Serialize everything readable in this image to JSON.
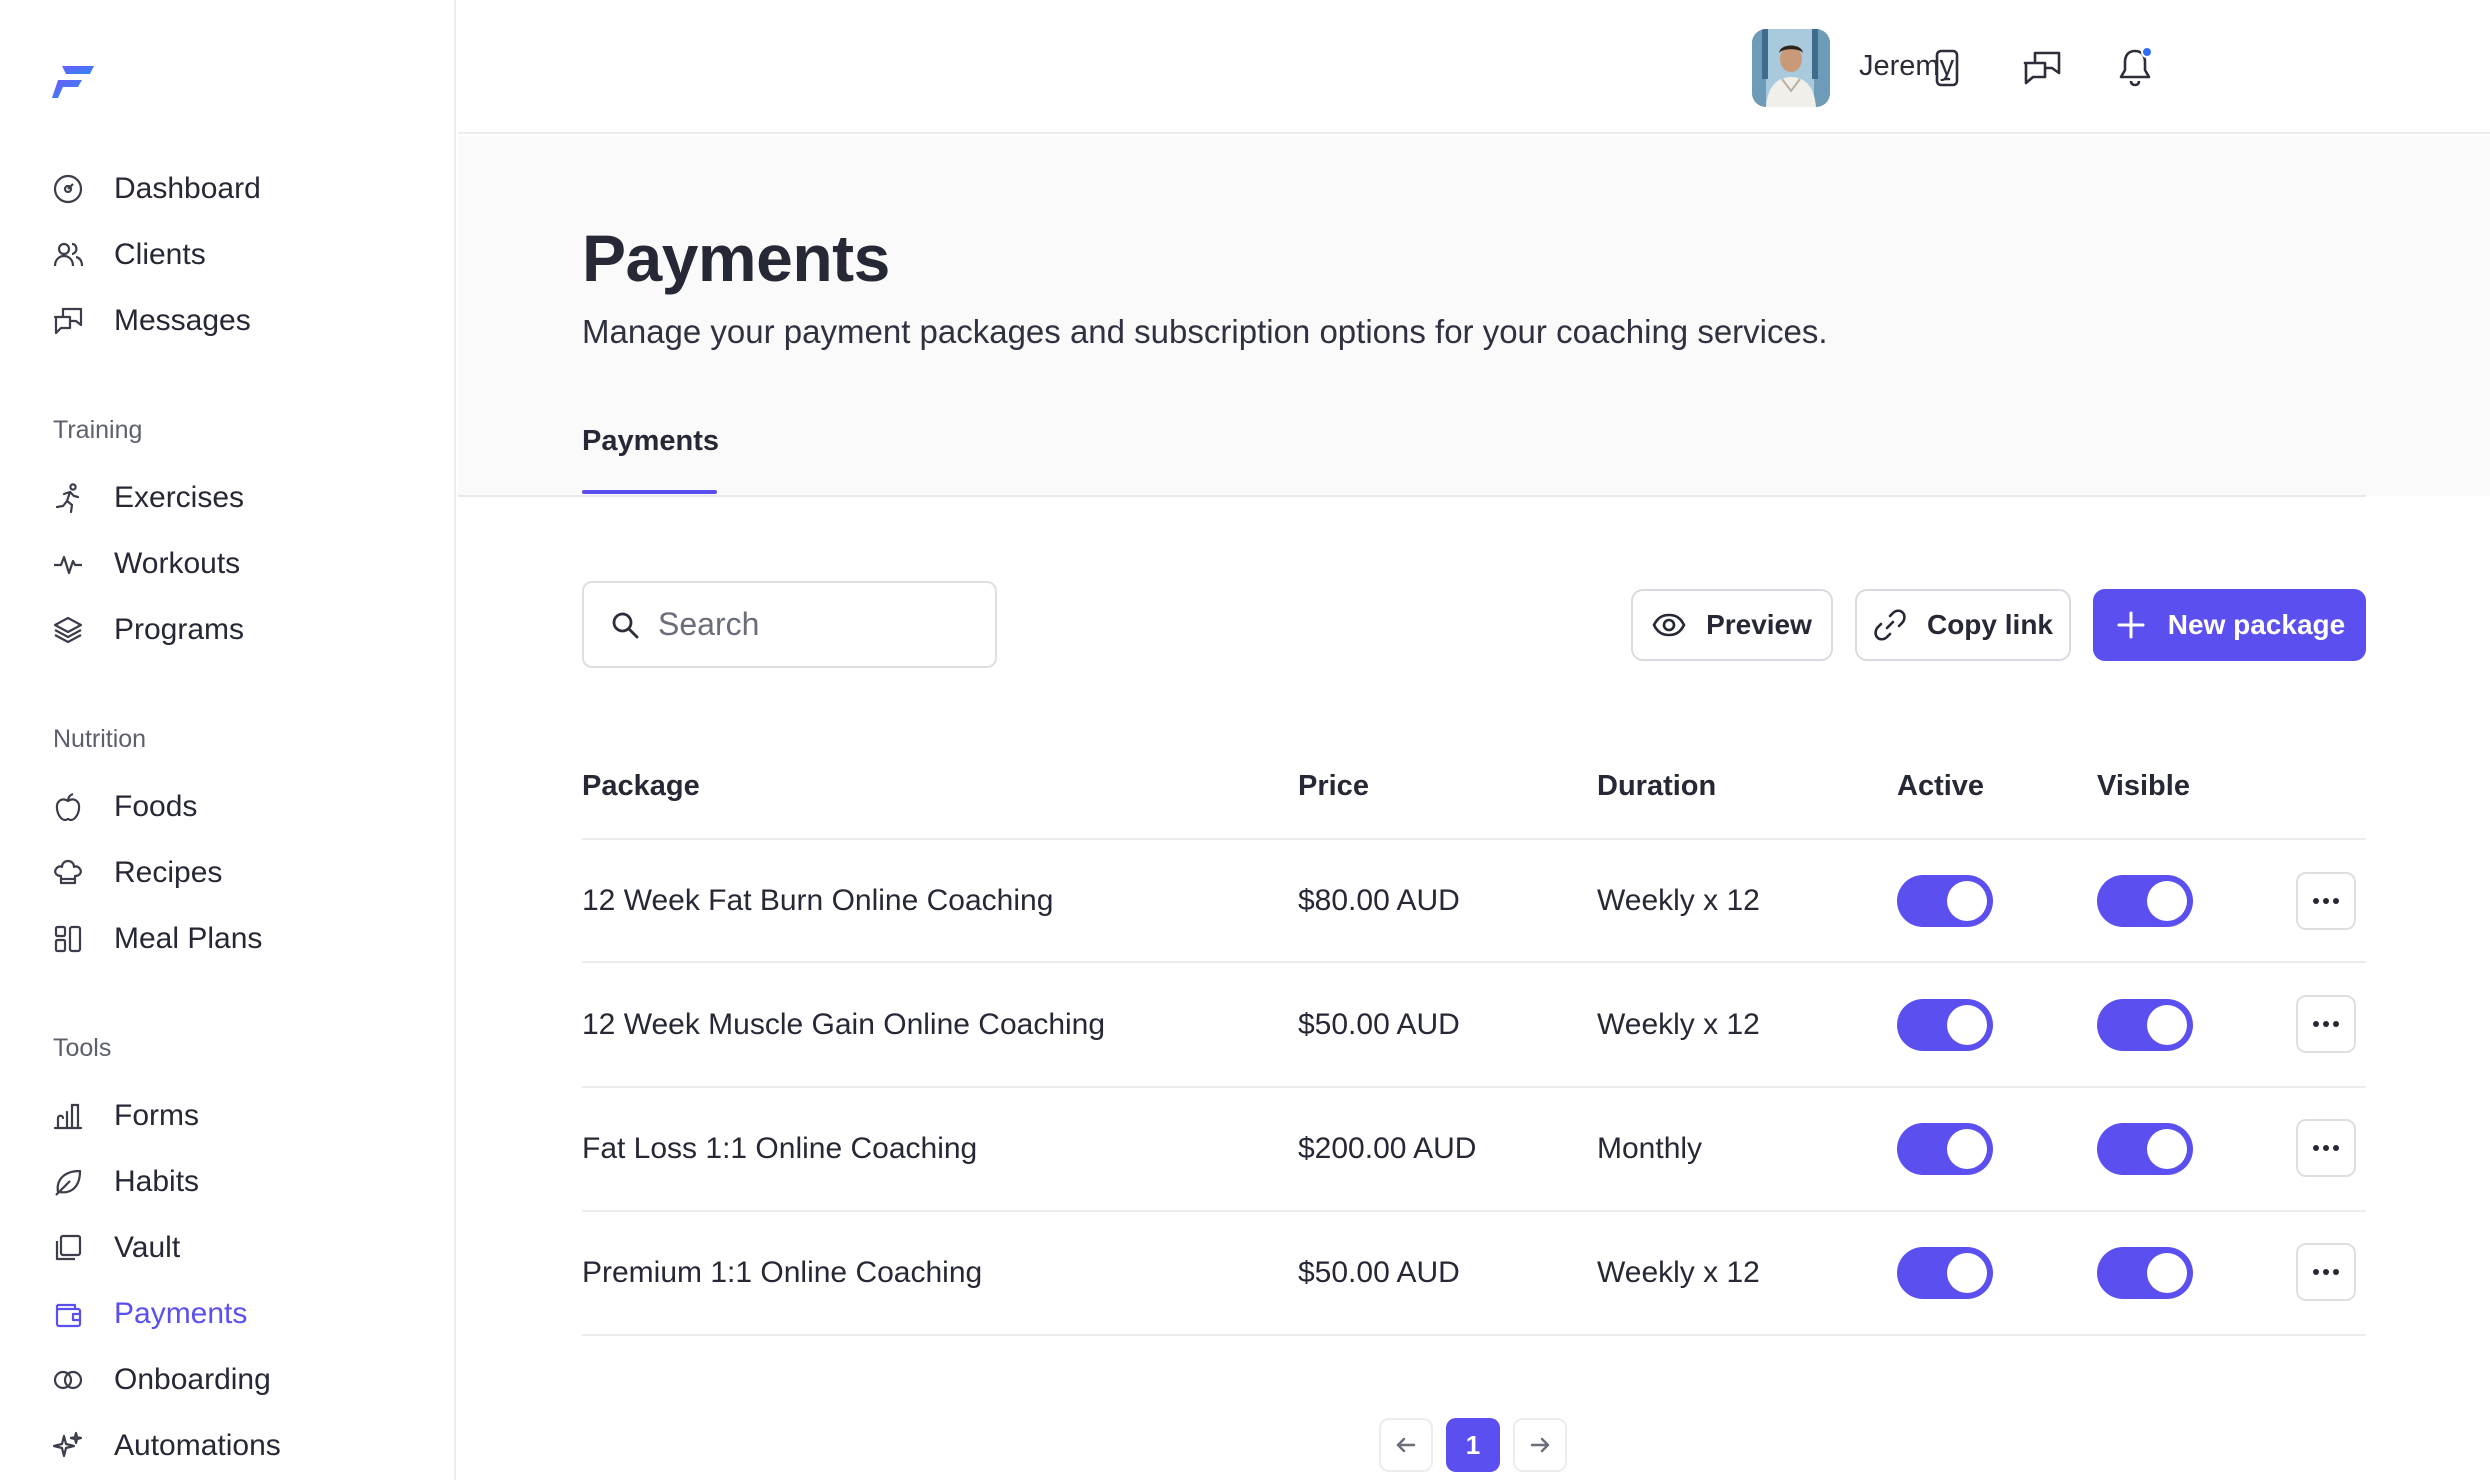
{
  "sidebar": {
    "primary": [
      {
        "label": "Dashboard",
        "icon": "gauge-icon"
      },
      {
        "label": "Clients",
        "icon": "users-icon"
      },
      {
        "label": "Messages",
        "icon": "messages-icon"
      }
    ],
    "sections": [
      {
        "title": "Training",
        "items": [
          {
            "label": "Exercises",
            "icon": "running-icon"
          },
          {
            "label": "Workouts",
            "icon": "pulse-icon"
          },
          {
            "label": "Programs",
            "icon": "layers-icon"
          }
        ]
      },
      {
        "title": "Nutrition",
        "items": [
          {
            "label": "Foods",
            "icon": "apple-icon"
          },
          {
            "label": "Recipes",
            "icon": "chef-hat-icon"
          },
          {
            "label": "Meal Plans",
            "icon": "meal-grid-icon"
          }
        ]
      },
      {
        "title": "Tools",
        "items": [
          {
            "label": "Forms",
            "icon": "forms-icon"
          },
          {
            "label": "Habits",
            "icon": "leaf-icon"
          },
          {
            "label": "Vault",
            "icon": "folders-icon"
          },
          {
            "label": "Payments",
            "icon": "wallet-icon",
            "active": true
          },
          {
            "label": "Onboarding",
            "icon": "rings-icon"
          },
          {
            "label": "Automations",
            "icon": "sparkles-icon"
          }
        ]
      }
    ]
  },
  "topbar": {
    "user_name": "Jeremy"
  },
  "header": {
    "title": "Payments",
    "subtitle": "Manage your payment packages and subscription options for your coaching services.",
    "tabs": [
      {
        "label": "Payments",
        "active": true
      }
    ]
  },
  "toolbar": {
    "search_placeholder": "Search",
    "preview_label": "Preview",
    "copy_link_label": "Copy link",
    "new_package_label": "New package"
  },
  "table": {
    "columns": [
      "Package",
      "Price",
      "Duration",
      "Active",
      "Visible"
    ],
    "rows": [
      {
        "package": "12 Week Fat Burn Online Coaching",
        "price": "$80.00 AUD",
        "duration": "Weekly x 12",
        "active": true,
        "visible": true
      },
      {
        "package": "12 Week Muscle Gain Online Coaching",
        "price": "$50.00 AUD",
        "duration": "Weekly x 12",
        "active": true,
        "visible": true
      },
      {
        "package": "Fat Loss 1:1 Online Coaching",
        "price": "$200.00 AUD",
        "duration": "Monthly",
        "active": true,
        "visible": true
      },
      {
        "package": "Premium 1:1 Online Coaching",
        "price": "$50.00 AUD",
        "duration": "Weekly x 12",
        "active": true,
        "visible": true
      }
    ]
  },
  "pagination": {
    "current_page": "1"
  },
  "colors": {
    "accent": "#5b4ff0",
    "notification_dot": "#2f6ef5",
    "border": "#ececef"
  }
}
